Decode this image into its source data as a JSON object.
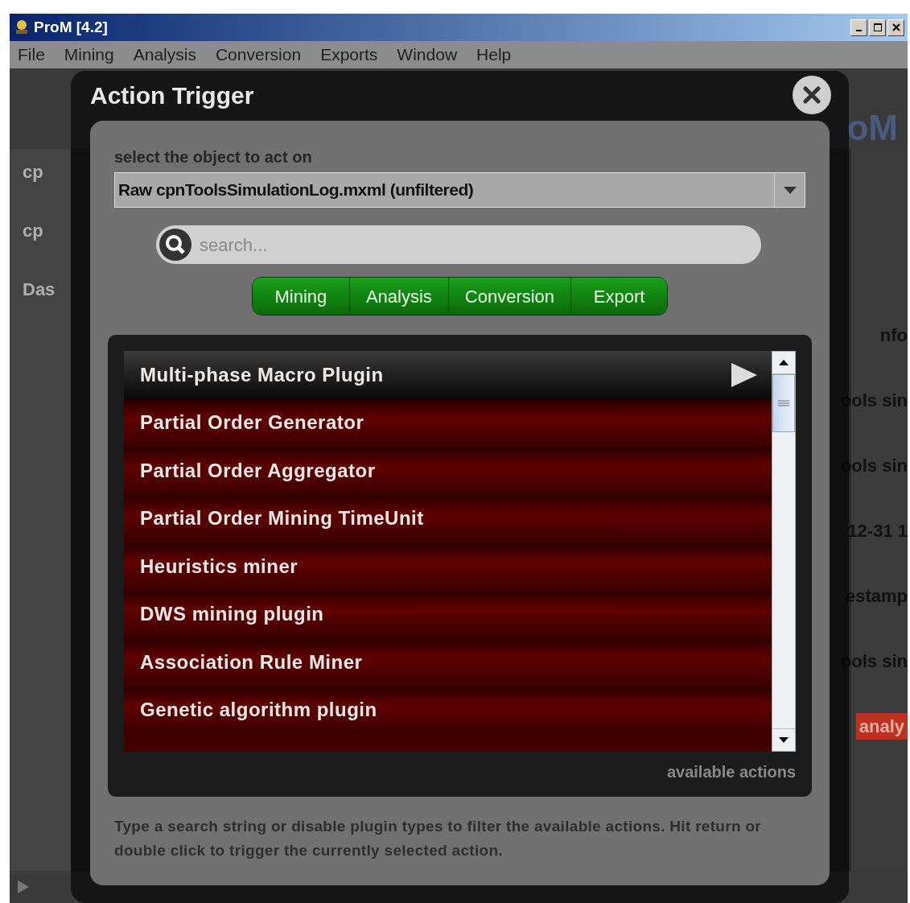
{
  "window": {
    "title": "ProM [4.2]"
  },
  "menu": [
    "File",
    "Mining",
    "Analysis",
    "Conversion",
    "Exports",
    "Window",
    "Help"
  ],
  "logo": "oM",
  "background": {
    "left_texts": [
      "cp",
      "cp",
      "Das"
    ],
    "right_texts": [
      "nfo",
      "ools sin",
      "ools sin",
      "12-31 1",
      "estamp",
      "ools sin"
    ],
    "action_button": "analy"
  },
  "dialog": {
    "title": "Action Trigger",
    "object_label": "select the object to act on",
    "object_value": "Raw cpnToolsSimulationLog.mxml (unfiltered)",
    "search": {
      "placeholder": "search..."
    },
    "plugin_types": [
      {
        "label": "Mining",
        "on": true
      },
      {
        "label": "Analysis",
        "on": true
      },
      {
        "label": "Conversion",
        "on": true
      },
      {
        "label": "Export",
        "on": true
      }
    ],
    "actions": [
      {
        "label": "Multi-phase Macro Plugin",
        "selected": true
      },
      {
        "label": "Partial Order Generator",
        "selected": false
      },
      {
        "label": "Partial Order Aggregator",
        "selected": false
      },
      {
        "label": "Partial Order Mining TimeUnit",
        "selected": false
      },
      {
        "label": "Heuristics miner",
        "selected": false
      },
      {
        "label": "DWS mining plugin",
        "selected": false
      },
      {
        "label": "Association Rule Miner",
        "selected": false
      },
      {
        "label": "Genetic algorithm plugin",
        "selected": false
      }
    ],
    "list_caption": "available actions",
    "help": "Type a search string or disable plugin types to filter the available actions. Hit return or double click to trigger the currently selected action."
  }
}
